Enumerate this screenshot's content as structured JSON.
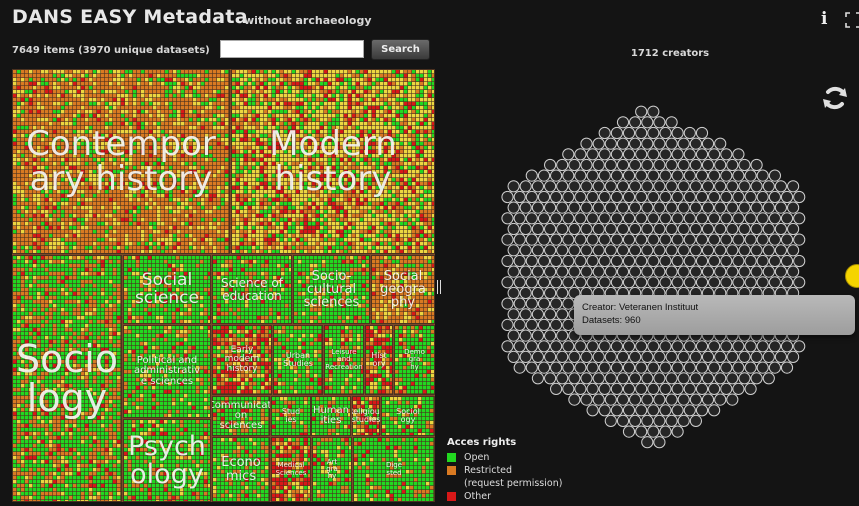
{
  "header": {
    "title": "DANS EASY Metadata",
    "subtitle": "without archaeology",
    "item_count": "7649 items (3970 unique datasets)",
    "search_placeholder": "",
    "search_label": "Search"
  },
  "treemap": {
    "colors": {
      "open": "#22d820",
      "restricted": "#d97a22",
      "other": "#d81818",
      "highlight": "#ecd640"
    },
    "regions": [
      {
        "label": "Contempor\nary history",
        "mix": "restricted"
      },
      {
        "label": "Modern\nhistory",
        "mix": "yellowred"
      },
      {
        "label": "Social\nscience",
        "mix": "green"
      },
      {
        "label": "Science of\neducation",
        "mix": "green"
      },
      {
        "label": "Socio-\ncultural\nsciences",
        "mix": "green"
      },
      {
        "label": "Social\ngeogra\nphy",
        "mix": "restricted"
      },
      {
        "label": "Socio\nlogy",
        "mix": "greenorange"
      },
      {
        "label": "Political and\nadministrativ\ne sciences",
        "mix": "green"
      },
      {
        "label": "Early\nmodern\nhistory",
        "mix": "red"
      },
      {
        "label": "Urban\nStudies",
        "mix": "green"
      },
      {
        "label": "Leisure\nand\nRecreation",
        "mix": "green"
      },
      {
        "label": "Hist\nory",
        "mix": "red"
      },
      {
        "label": "Demo\ngra\nhy",
        "mix": "green"
      },
      {
        "label": "Communicati\non\nsciences",
        "mix": "green"
      },
      {
        "label": "Stud\nies",
        "mix": "green"
      },
      {
        "label": "Human\nities",
        "mix": "green"
      },
      {
        "label": "Religious\nstudies",
        "mix": "red"
      },
      {
        "label": "Sociol\nogy",
        "mix": "green"
      },
      {
        "label": "Psych\nology",
        "mix": "green"
      },
      {
        "label": "Econo\nmics",
        "mix": "green"
      },
      {
        "label": "Medical\nSciences",
        "mix": "red"
      },
      {
        "label": "Art\ngra\nhy",
        "mix": "green"
      },
      {
        "label": "Dige\nsted",
        "mix": "green"
      }
    ]
  },
  "creators": {
    "count_label": "1712 creators",
    "tooltip": {
      "creator": "Creator: Veteranen Instituut",
      "datasets": "Datasets: 960"
    }
  },
  "legend": {
    "title": "Acces rights",
    "items": [
      {
        "label": "Open",
        "color": "#22d820",
        "sub": ""
      },
      {
        "label": "Restricted",
        "color": "#d97a22",
        "sub": "(request permission)"
      },
      {
        "label": "Other",
        "color": "#d81818",
        "sub": ""
      }
    ]
  },
  "icons": [
    "info-icon",
    "fullscreen-icon",
    "refresh-icon"
  ]
}
